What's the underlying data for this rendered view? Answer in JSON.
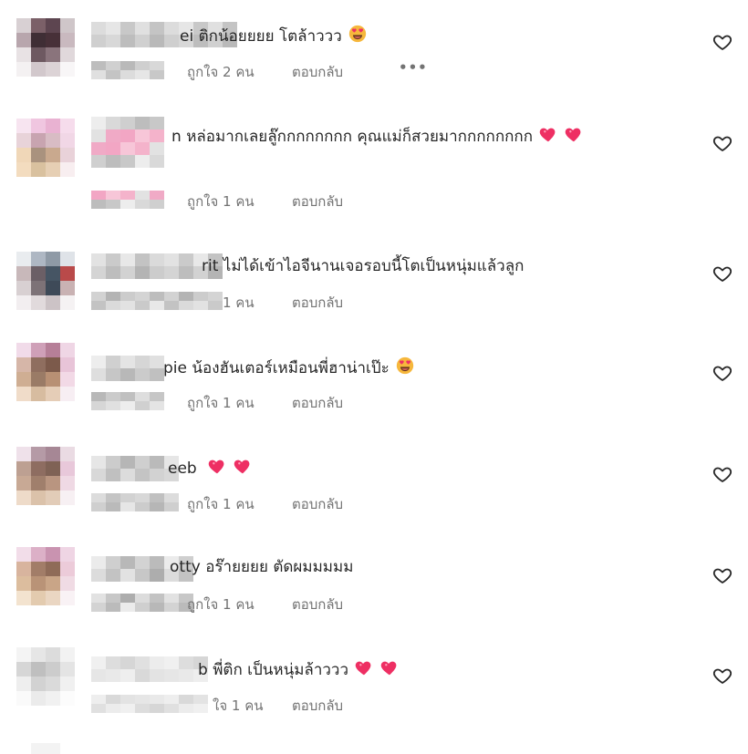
{
  "comments": [
    {
      "username_tail": "ei",
      "text": "ติกน้อยยยย โตล้าววว",
      "emojis": [
        "heart-eyes"
      ],
      "likes_label": "ถูกใจ 2 คน",
      "reply_label": "ตอบกลับ",
      "more_label": "•••",
      "colors": {
        "avatar": [
          "#d8d0d3",
          "#7b6068",
          "#5d4550",
          "#cfc6c9",
          "#b8a6ad",
          "#3f2e35",
          "#473038",
          "#c9b9bf",
          "#e8e2e4",
          "#6e5961",
          "#8a747c",
          "#e0d8db",
          "#f4f1f2",
          "#d2c8cc",
          "#dcd3d6",
          "#f8f6f7"
        ],
        "name": [
          "#dcdcdc",
          "#cfcfcf",
          "#e6e6e6",
          "#d8d8d8",
          "#c8c8c8",
          "#bdbdbd",
          "#e0e0e0",
          "#d0d0d0",
          "#c4c4c4",
          "#b9b9b9"
        ]
      }
    },
    {
      "username_tail": "n",
      "text": "หล่อมากเลยลู๊กกกกกกกก คุณแม่ก็สวยมากกกกกกกก",
      "emojis": [
        "heart",
        "heart"
      ],
      "likes_label": "ถูกใจ 1 คน",
      "reply_label": "ตอบกลับ",
      "colors": {
        "avatar": [
          "#f7e4f0",
          "#f0c6e0",
          "#e9b2d2",
          "#f6dcec",
          "#e8d3d9",
          "#c8a4b0",
          "#d8bcc4",
          "#f1d7e6",
          "#f0d7b8",
          "#a9927e",
          "#c9a98e",
          "#e9d2d9",
          "#f3dcbf",
          "#d9c19f",
          "#e6cfb4",
          "#f8eef0"
        ],
        "name": [
          "#ededed",
          "#e2e2e2",
          "#d9d9d9",
          "#f0aac6",
          "#cfcfcf",
          "#f2a6c4",
          "#bdbdbd",
          "#f7c6d8",
          "#c8c8c8",
          "#f4b3cb"
        ]
      }
    },
    {
      "username_tail": "rit",
      "text": "ไม่ได้เข้าไอจีนานเจอรอบนี้โตเป็นหนุ่มแล้วลูก",
      "emojis": [],
      "likes_label": "1 คน",
      "reply_label": "ตอบกลับ",
      "colors": {
        "avatar": [
          "#e9ecef",
          "#aeb7c3",
          "#8f9aa6",
          "#dfe3e8",
          "#c8b8ba",
          "#6b5f66",
          "#465564",
          "#b94a4a",
          "#d8d0d2",
          "#7d7277",
          "#3e4a58",
          "#c9b2b3",
          "#f2eef0",
          "#e1dadc",
          "#ccc3c6",
          "#f5f2f3"
        ],
        "name": [
          "#e2e2e2",
          "#d4d4d4",
          "#cacaca",
          "#bdbdbd",
          "#e8e8e8",
          "#d2d2d2",
          "#c3c3c3",
          "#b4b4b4",
          "#dadada",
          "#cccccc"
        ]
      }
    },
    {
      "username_tail": "pie",
      "text": "น้องฮันเตอร์เหมือนพี่ฮาน่าเป๊ะ",
      "emojis": [
        "heart-eyes"
      ],
      "likes_label": "ถูกใจ 1 คน",
      "reply_label": "ตอบกลับ",
      "colors": {
        "avatar": [
          "#f1dbe9",
          "#cfa0b8",
          "#b67f98",
          "#efd6e5",
          "#d6b6a8",
          "#8f6e5f",
          "#7c5a4b",
          "#e8c4d8",
          "#cfae93",
          "#9a7b66",
          "#b89074",
          "#f2d9e6",
          "#f0dcc9",
          "#d7bca0",
          "#e5cdb7",
          "#f7eef3"
        ],
        "name": [
          "#ededed",
          "#dedede",
          "#d0d0d0",
          "#c6c6c6",
          "#e4e4e4",
          "#b8b8b8",
          "#d6d6d6",
          "#cbcbcb",
          "#e0e0e0",
          "#c0c0c0"
        ]
      }
    },
    {
      "username_tail": "eeb",
      "text": "",
      "emojis": [
        "heart",
        "heart"
      ],
      "likes_label": "ถูกใจ 1 คน",
      "reply_label": "ตอบกลับ",
      "colors": {
        "avatar": [
          "#efe1ea",
          "#b59aa6",
          "#a68795",
          "#eadbe3",
          "#bda092",
          "#8e6d61",
          "#7f6255",
          "#e8c8da",
          "#c8a995",
          "#a07f6c",
          "#b99580",
          "#efd9e4",
          "#eedbc9",
          "#dbc2aa",
          "#e2ccb8",
          "#f7f0f3"
        ],
        "name": [
          "#e6e6e6",
          "#d8d8d8",
          "#cccccc",
          "#c0c0c0",
          "#b6b6b6",
          "#dcdcdc",
          "#cfcfcf",
          "#c4c4c4",
          "#bababa",
          "#d2d2d2"
        ]
      }
    },
    {
      "username_tail": "otty",
      "text": "อร๊ายยยย ตัดผมมมมม",
      "emojis": [],
      "likes_label": "ถูกใจ 1 คน",
      "reply_label": "ตอบกลับ",
      "colors": {
        "avatar": [
          "#f2dde9",
          "#dcb0c7",
          "#c993b0",
          "#efd5e4",
          "#d8b49e",
          "#a27d68",
          "#8f6b58",
          "#eccbd9",
          "#dcbd9e",
          "#b99377",
          "#c9a587",
          "#f0dbe4",
          "#f3e3cf",
          "#e3cbaf",
          "#ead6c2",
          "#f9f2f5"
        ],
        "name": [
          "#ebebeb",
          "#dcdcdc",
          "#cfcfcf",
          "#c3c3c3",
          "#b8b8b8",
          "#e2e2e2",
          "#d3d3d3",
          "#c7c7c7",
          "#bbbbbb",
          "#adadad"
        ]
      }
    },
    {
      "username_tail": "b",
      "text": "พี่ติก เป็นหนุ่มล้าววว",
      "emojis": [
        "heart",
        "heart"
      ],
      "likes_label": "ใจ 1 คน",
      "reply_label": "ตอบกลับ",
      "colors": {
        "avatar": [
          "#f4f4f4",
          "#e6e6e6",
          "#dcdcdc",
          "#f2f2f2",
          "#d6d6d6",
          "#bfbfbf",
          "#cccccc",
          "#e4e4e4",
          "#eeeeee",
          "#d2d2d2",
          "#dadada",
          "#f0f0f0",
          "#fafafa",
          "#ebebeb",
          "#f1f1f1",
          "#fcfcfc"
        ],
        "name": [
          "#f0f0f0",
          "#e6e6e6",
          "#dddddd",
          "#e9e9e9",
          "#d6d6d6",
          "#eeeeee",
          "#e0e0e0",
          "#d9d9d9",
          "#ececec",
          "#e3e3e3"
        ]
      }
    }
  ],
  "theme": {
    "text": "#262626",
    "muted": "#737373",
    "heart_red": "#ee2f63",
    "emoji_yellow": "#f6b73c"
  }
}
